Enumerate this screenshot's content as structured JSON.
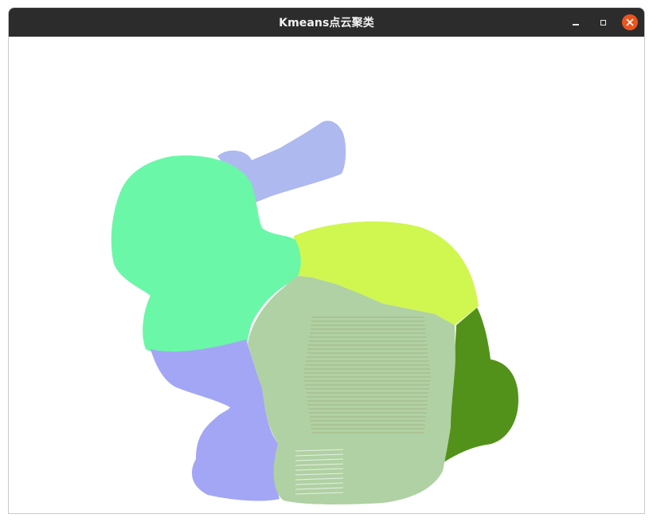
{
  "window": {
    "title": "Kmeans点云聚类"
  },
  "controls": {
    "minimize": "minimize-icon",
    "maximize": "maximize-icon",
    "close": "close-icon"
  },
  "point_cloud": {
    "object": "bunny",
    "background": "#ffffff",
    "cluster_colors": {
      "head": "#6af7a8",
      "ear": "#aeb9ef",
      "back": "#d0f650",
      "tail": "#52921a",
      "front_leg": "#a3a6f4",
      "body": "#b0d1a3",
      "stripe": "#8d6b3b"
    }
  }
}
